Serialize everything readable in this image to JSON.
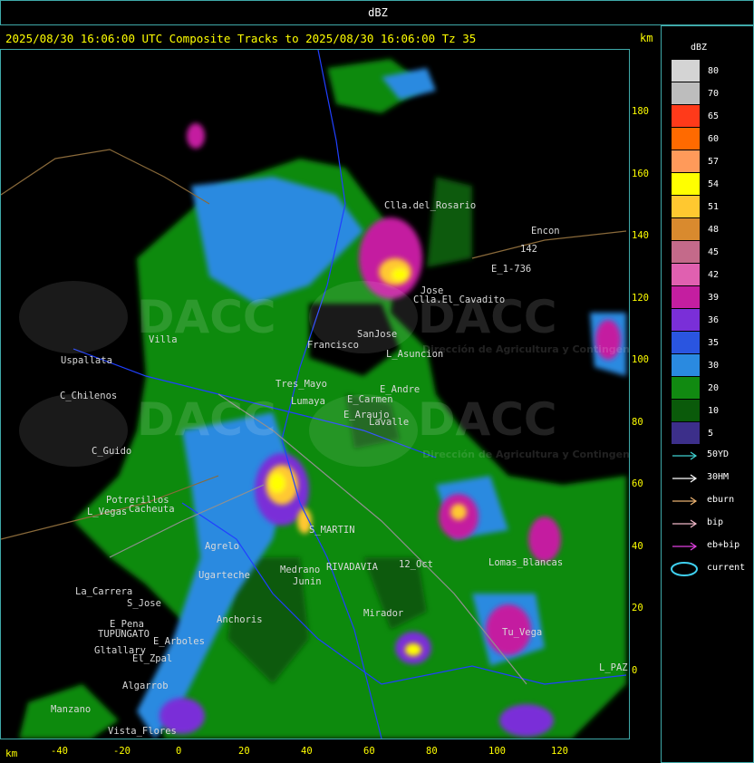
{
  "window": {
    "title": "dBZ"
  },
  "header": {
    "text": "2025/08/30 16:06:00 UTC Composite Tracks to 2025/08/30 16:06:00 Tz 35",
    "km_label": "km"
  },
  "axes": {
    "x_unit": "km",
    "y_unit": "km",
    "x_ticks": [
      "-40",
      "-20",
      "0",
      "20",
      "40",
      "60",
      "80",
      "100",
      "120"
    ],
    "y_ticks": [
      "180",
      "160",
      "140",
      "120",
      "100",
      "80",
      "60",
      "40",
      "20",
      "0"
    ]
  },
  "legend": {
    "title": "dBZ",
    "levels": [
      {
        "label": "80",
        "color": "#d4d4d4"
      },
      {
        "label": "70",
        "color": "#bdbdbd"
      },
      {
        "label": "65",
        "color": "#ff3a1a"
      },
      {
        "label": "60",
        "color": "#ff6a00"
      },
      {
        "label": "57",
        "color": "#ff9a5a"
      },
      {
        "label": "54",
        "color": "#ffff00"
      },
      {
        "label": "51",
        "color": "#ffc830"
      },
      {
        "label": "48",
        "color": "#d98a2e"
      },
      {
        "label": "45",
        "color": "#c46a8a"
      },
      {
        "label": "42",
        "color": "#e060b0"
      },
      {
        "label": "39",
        "color": "#c41ea0"
      },
      {
        "label": "36",
        "color": "#7a2fd8"
      },
      {
        "label": "35",
        "color": "#2a55e0"
      },
      {
        "label": "30",
        "color": "#2a8ae0"
      },
      {
        "label": "20",
        "color": "#118a11"
      },
      {
        "label": "10",
        "color": "#0a5a0a"
      },
      {
        "label": "5",
        "color": "#3c2f8a"
      }
    ],
    "tracks": [
      {
        "label": "50YD",
        "color": "#3fd0d0"
      },
      {
        "label": "30HM",
        "color": "#ffffff"
      },
      {
        "label": "eburn",
        "color": "#e8b070"
      },
      {
        "label": "bip",
        "color": "#f0b8c8"
      },
      {
        "label": "eb+bip",
        "color": "#e040e0"
      },
      {
        "label": "current",
        "color": "#3fd0f0"
      }
    ]
  },
  "places": [
    {
      "name": "Clla.del_Rosario"
    },
    {
      "name": "Encon"
    },
    {
      "name": "142"
    },
    {
      "name": "E_1-736"
    },
    {
      "name": "Jose"
    },
    {
      "name": "Clla.El_Cavadito"
    },
    {
      "name": "Villa"
    },
    {
      "name": "Uspallata"
    },
    {
      "name": "Francisco"
    },
    {
      "name": "SanJose"
    },
    {
      "name": "L_Asuncion"
    },
    {
      "name": "C_Chilenos"
    },
    {
      "name": "Tres_Mayo"
    },
    {
      "name": "E_Andre"
    },
    {
      "name": "Lumaya"
    },
    {
      "name": "E_Carmen"
    },
    {
      "name": "E_Araujo"
    },
    {
      "name": "Lavalle"
    },
    {
      "name": "C_Guido"
    },
    {
      "name": "Potrerillos"
    },
    {
      "name": "L_Vegas"
    },
    {
      "name": "Cacheuta"
    },
    {
      "name": "S_MARTIN"
    },
    {
      "name": "Agrelo"
    },
    {
      "name": "Ugarteche"
    },
    {
      "name": "RIVADAVIA"
    },
    {
      "name": "12_Oct"
    },
    {
      "name": "Lomas_Blancas"
    },
    {
      "name": "La_Carrera"
    },
    {
      "name": "S_Jose"
    },
    {
      "name": "E_Pena"
    },
    {
      "name": "TUPUNGATO"
    },
    {
      "name": "Anchoris"
    },
    {
      "name": "Gltallary"
    },
    {
      "name": "E_Arboles"
    },
    {
      "name": "Algarrob"
    },
    {
      "name": "Vista_Flores"
    },
    {
      "name": "Manzano"
    },
    {
      "name": "L_PAZ"
    },
    {
      "name": "Tu_Vega"
    },
    {
      "name": "Mirador"
    },
    {
      "name": "Medrano"
    },
    {
      "name": "Junin"
    },
    {
      "name": "El_Zpal"
    }
  ],
  "watermark": {
    "text": "DACC",
    "subtitle": "Dirección de Agricultura y Contingencias Climáticas"
  }
}
